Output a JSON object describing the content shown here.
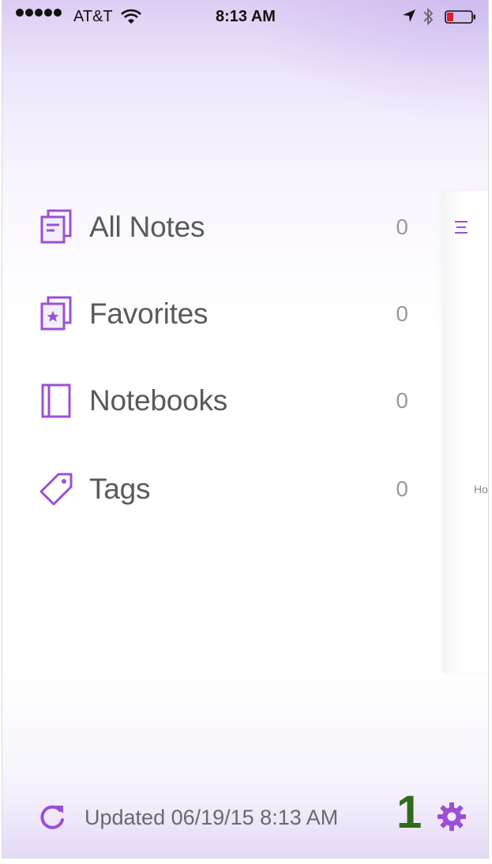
{
  "status_bar": {
    "carrier": "AT&T",
    "time": "8:13 AM",
    "icons": [
      "signal-dots-icon",
      "wifi-icon",
      "location-arrow-icon",
      "bluetooth-icon",
      "battery-low-icon"
    ]
  },
  "menu": {
    "items": [
      {
        "label": "All Notes",
        "count": "0",
        "icon": "all-notes-icon"
      },
      {
        "label": "Favorites",
        "count": "0",
        "icon": "favorites-icon"
      },
      {
        "label": "Notebooks",
        "count": "0",
        "icon": "notebooks-icon"
      },
      {
        "label": "Tags",
        "count": "0",
        "icon": "tags-icon"
      }
    ]
  },
  "background_card": {
    "snippet": "Hol"
  },
  "footer": {
    "updated_text": "Updated 06/19/15 8:13 AM",
    "annotation": "1"
  },
  "colors": {
    "accent": "#9b4fd4",
    "label": "#5a5a5a",
    "count": "#9a9a9a",
    "annotation": "#2f6b1c"
  }
}
